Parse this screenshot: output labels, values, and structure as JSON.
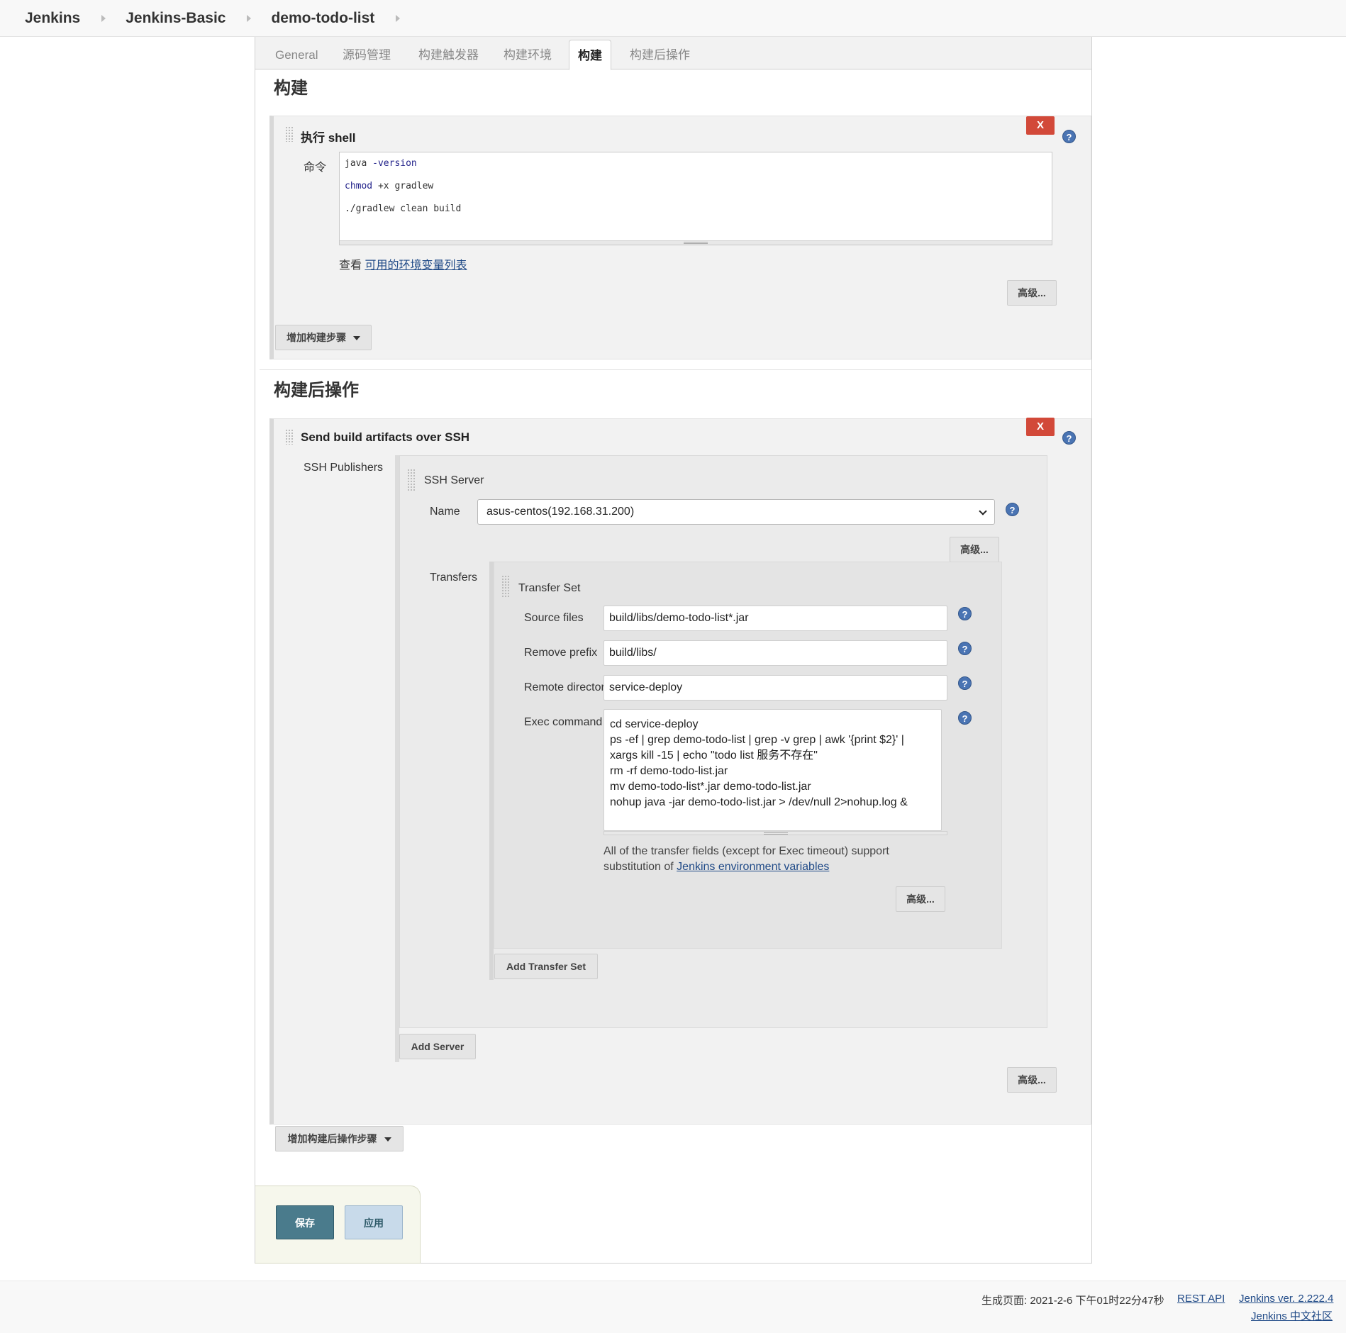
{
  "breadcrumb": {
    "items": [
      "Jenkins",
      "Jenkins-Basic",
      "demo-todo-list"
    ]
  },
  "tabs": [
    {
      "label": "General"
    },
    {
      "label": "源码管理"
    },
    {
      "label": "构建触发器"
    },
    {
      "label": "构建环境"
    },
    {
      "label": "构建"
    },
    {
      "label": "构建后操作"
    }
  ],
  "build": {
    "section_title": "构建",
    "step_title": "执行 shell",
    "delete_label": "X",
    "help_label": "?",
    "command_label": "命令",
    "command_lines": [
      {
        "cmd": "java",
        "rest": " -version"
      },
      {
        "cmd": "chmod",
        "rest": " +x gradlew"
      },
      {
        "cmd": "",
        "rest": "./gradlew clean build"
      }
    ],
    "env_prefix": "查看 ",
    "env_link": "可用的环境变量列表",
    "advanced_label": "高级...",
    "add_step_label": "增加构建步骤"
  },
  "post_build": {
    "section_title": "构建后操作",
    "step_title": "Send build artifacts over SSH",
    "delete_label": "X",
    "ssh_publishers_label": "SSH Publishers",
    "ssh_server_label": "SSH Server",
    "name_label": "Name",
    "name_value": "asus-centos(192.168.31.200)",
    "server_advanced_label": "高级...",
    "transfers_label": "Transfers",
    "transfer_set_label": "Transfer Set",
    "source_files_label": "Source files",
    "source_files_value": "build/libs/demo-todo-list*.jar",
    "remove_prefix_label": "Remove prefix",
    "remove_prefix_value": "build/libs/",
    "remote_directory_label": "Remote directory",
    "remote_directory_value": "service-deploy",
    "exec_command_label": "Exec command",
    "exec_command_value": "cd service-deploy\nps -ef | grep demo-todo-list | grep -v grep | awk '{print $2}' |\nxargs kill -15 | echo \"todo list 服务不存在\"\nrm -rf demo-todo-list.jar\nmv demo-todo-list*.jar demo-todo-list.jar\nnohup java -jar demo-todo-list.jar > /dev/null 2>nohup.log &",
    "note_text": "All of the transfer fields (except for Exec timeout) support",
    "note_text2": "substitution of ",
    "note_link": "Jenkins environment variables",
    "transfer_advanced_label": "高级...",
    "add_transfer_set_label": "Add Transfer Set",
    "add_server_label": "Add Server",
    "publisher_advanced_label": "高级...",
    "add_post_step_label": "增加构建后操作步骤"
  },
  "actions": {
    "save_label": "保存",
    "apply_label": "应用"
  },
  "footer": {
    "generated": "生成页面: 2021-2-6 下午01时22分47秒",
    "rest_api": "REST API",
    "version": "Jenkins ver. 2.222.4",
    "community": "Jenkins 中文社区"
  },
  "colors": {
    "delete_button": "#d24939",
    "help_icon": "#4a74b3",
    "save_button": "#4a7b8c",
    "apply_button": "#c8daea",
    "link": "#204a87"
  }
}
